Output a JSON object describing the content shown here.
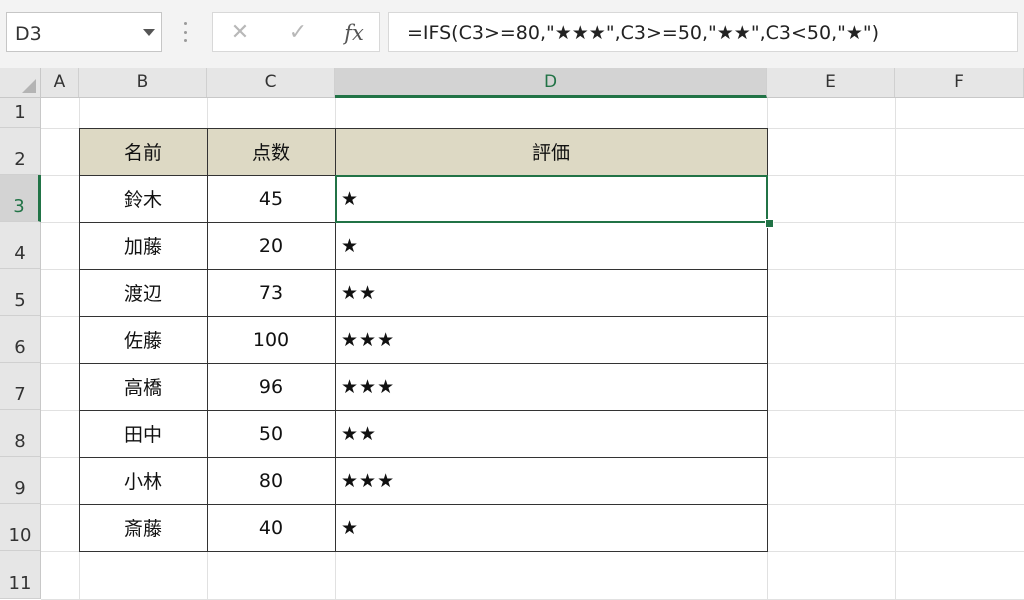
{
  "name_box": {
    "value": "D3"
  },
  "formula_bar": {
    "cancel_icon": "✕",
    "enter_icon": "✓",
    "insert_function_label": "fx",
    "formula": "=IFS(C3>=80,\"★★★\",C3>=50,\"★★\",C3<50,\"★\")"
  },
  "columns": [
    "A",
    "B",
    "C",
    "D",
    "E",
    "F"
  ],
  "rows": [
    "1",
    "2",
    "3",
    "4",
    "5",
    "6",
    "7",
    "8",
    "9",
    "10",
    "11"
  ],
  "active_column": "D",
  "active_row": "3",
  "table": {
    "headers": [
      "名前",
      "点数",
      "評価"
    ],
    "rows": [
      {
        "name": "鈴木",
        "score": "45",
        "rating": "★"
      },
      {
        "name": "加藤",
        "score": "20",
        "rating": "★"
      },
      {
        "name": "渡辺",
        "score": "73",
        "rating": "★★"
      },
      {
        "name": "佐藤",
        "score": "100",
        "rating": "★★★"
      },
      {
        "name": "高橋",
        "score": "96",
        "rating": "★★★"
      },
      {
        "name": "田中",
        "score": "50",
        "rating": "★★"
      },
      {
        "name": "小林",
        "score": "80",
        "rating": "★★★"
      },
      {
        "name": "斎藤",
        "score": "40",
        "rating": "★"
      }
    ]
  },
  "colors": {
    "accent": "#217346",
    "header_fill": "#ddd9c4"
  }
}
